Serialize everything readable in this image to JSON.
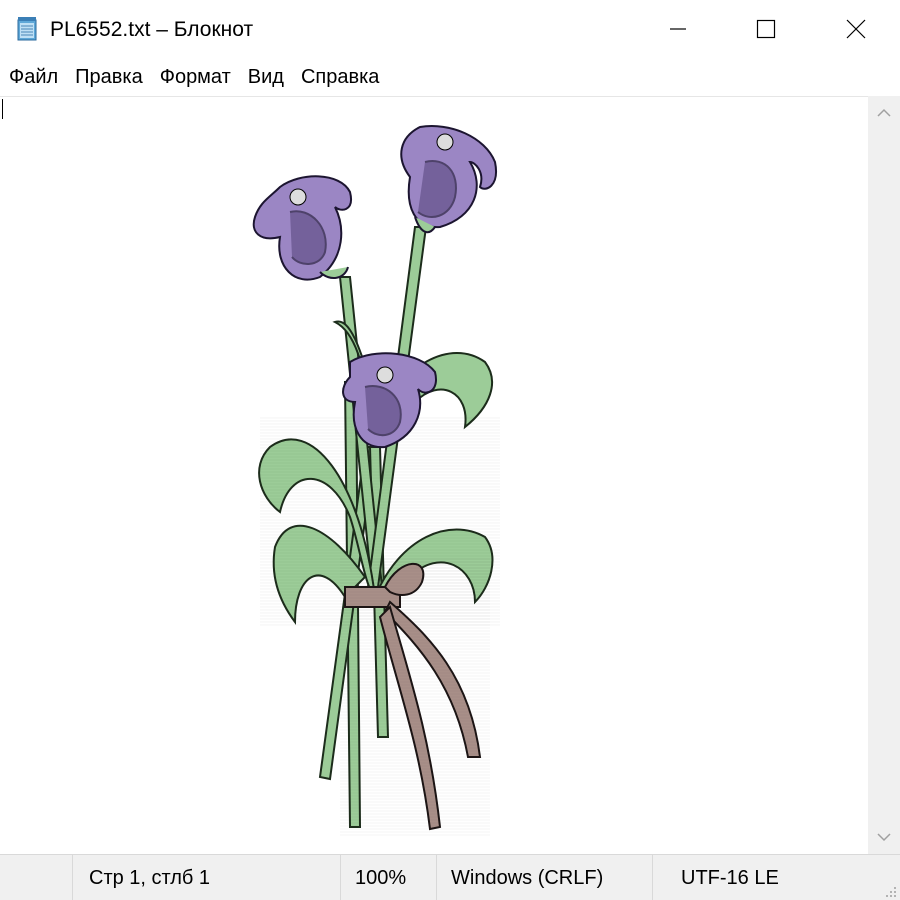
{
  "window": {
    "title": "PL6552.txt – Блокнот",
    "icon": "notepad-icon"
  },
  "controls": {
    "minimize_icon": "minimize-icon",
    "maximize_icon": "maximize-icon",
    "close_icon": "close-icon"
  },
  "menu": {
    "items": [
      {
        "label": "Файл"
      },
      {
        "label": "Правка"
      },
      {
        "label": "Формат"
      },
      {
        "label": "Вид"
      },
      {
        "label": "Справка"
      }
    ]
  },
  "editor": {
    "content": "ASCII/halftone art of a bouquet of three purple lily flowers with green leaves tied with a brown ribbon",
    "colors": {
      "petal": "#9b86c4",
      "petal_dark": "#5b4a80",
      "leaf": "#9ccc98",
      "leaf_dark": "#2f4a2e",
      "ribbon": "#a88f88"
    }
  },
  "scrollbar": {
    "up_icon": "chevron-up-icon",
    "down_icon": "chevron-down-icon"
  },
  "status": {
    "position": "Стр 1, стлб 1",
    "zoom": "100%",
    "line_ending": "Windows (CRLF)",
    "encoding": "UTF-16 LE"
  }
}
